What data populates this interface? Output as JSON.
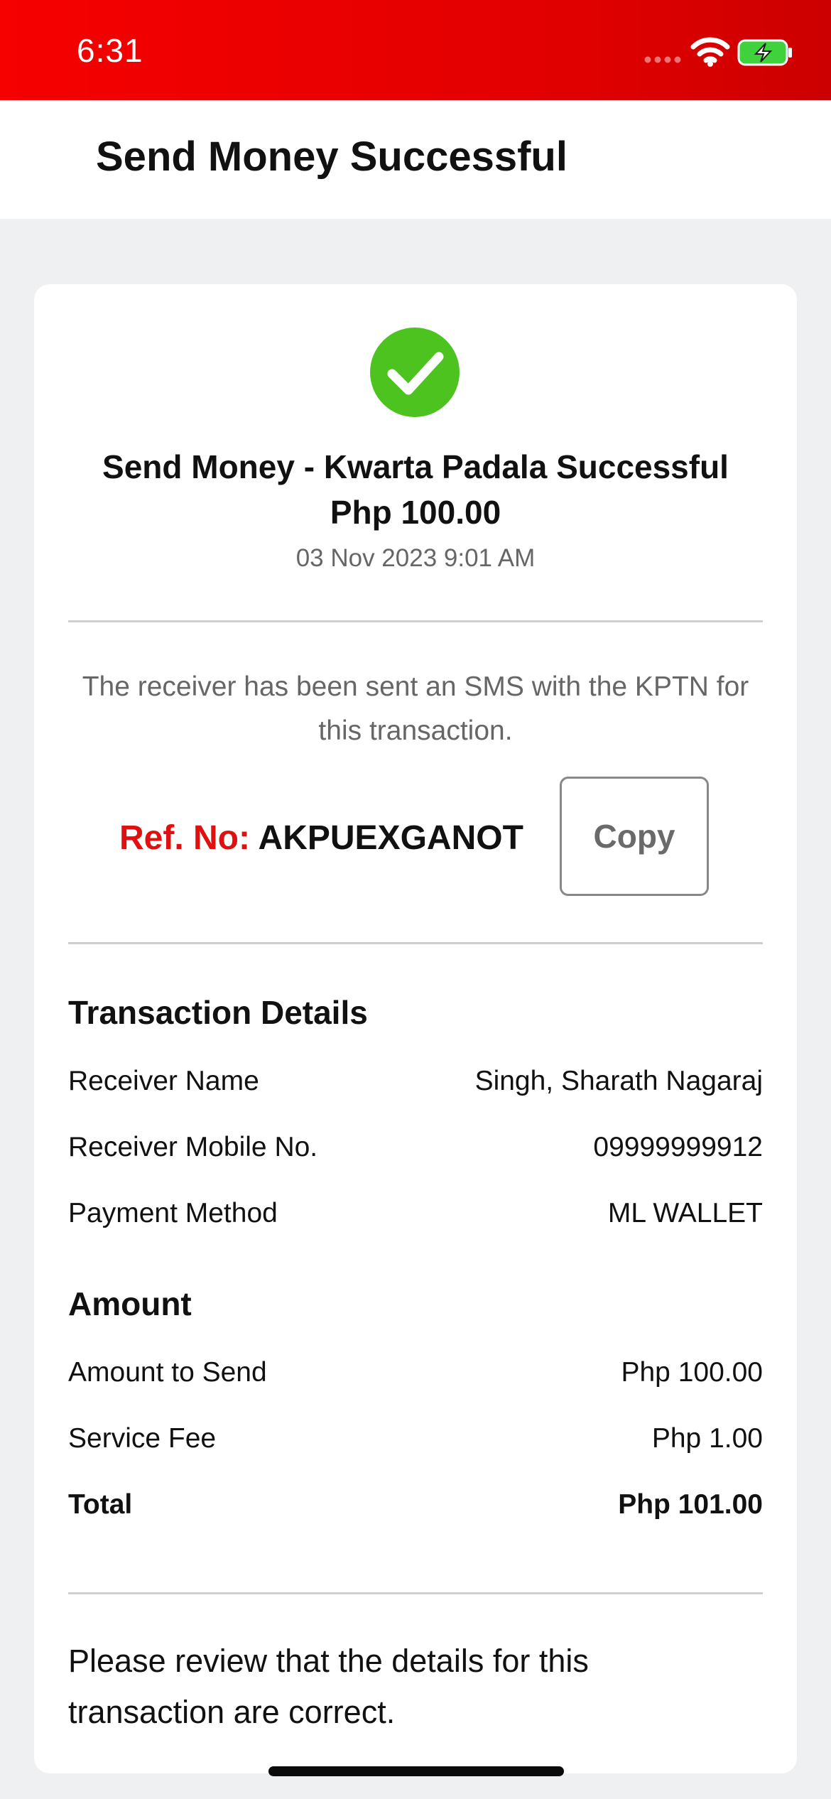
{
  "status_bar": {
    "time": "6:31"
  },
  "nav": {
    "title": "Send Money Successful"
  },
  "receipt": {
    "headline": "Send Money - Kwarta Padala Successful",
    "amount": "Php 100.00",
    "date": "03 Nov 2023 9:01 AM",
    "sms_note": "The receiver has been sent an SMS with the KPTN for this transaction.",
    "ref_label": "Ref. No:",
    "ref_value": "AKPUEXGANOT",
    "copy_label": "Copy"
  },
  "transaction_details": {
    "title": "Transaction Details",
    "rows": [
      {
        "label": "Receiver Name",
        "value": "Singh, Sharath Nagaraj"
      },
      {
        "label": "Receiver Mobile No.",
        "value": "09999999912"
      },
      {
        "label": "Payment Method",
        "value": "ML WALLET"
      }
    ]
  },
  "amount_section": {
    "title": "Amount",
    "rows": [
      {
        "label": "Amount to Send",
        "value": "Php 100.00"
      },
      {
        "label": "Service Fee",
        "value": "Php 1.00"
      },
      {
        "label": "Total",
        "value": "Php 101.00"
      }
    ]
  },
  "review_note": "Please review that the details for this transaction are correct.",
  "colors": {
    "status_bar": "#e00000",
    "accent_red": "#e01010",
    "success_green": "#4cc31f"
  },
  "icons": [
    "signal-icon",
    "wifi-icon",
    "battery-charging-icon",
    "checkmark-circle-icon"
  ]
}
